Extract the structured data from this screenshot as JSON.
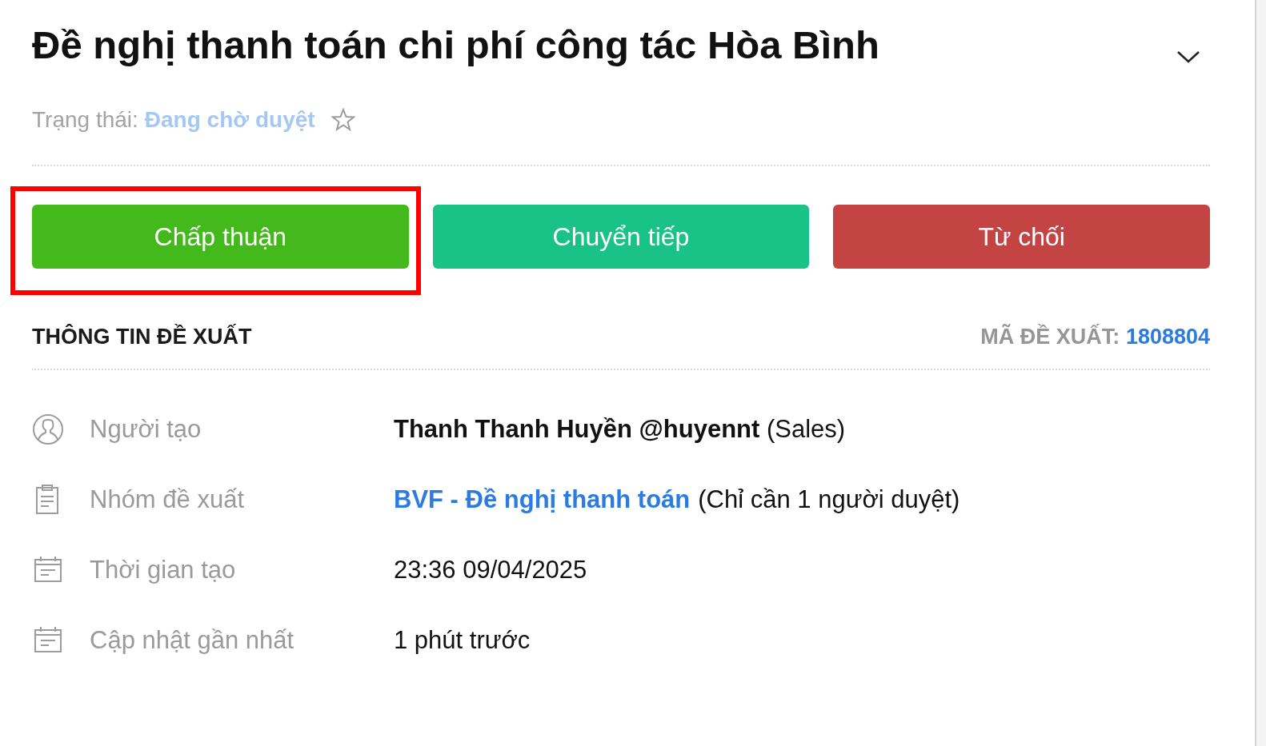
{
  "title": "Đề nghị thanh toán chi phí công tác Hòa Bình",
  "status": {
    "label": "Trạng thái:",
    "value": "Đang chờ duyệt",
    "starred": false
  },
  "actions": [
    {
      "label": "Chấp thuận",
      "color": "#44b91b",
      "highlighted": true
    },
    {
      "label": "Chuyển tiếp",
      "color": "#19c287",
      "highlighted": false
    },
    {
      "label": "Từ chối",
      "color": "#c44444",
      "highlighted": false
    }
  ],
  "section": {
    "title": "THÔNG TIN ĐỀ XUẤT",
    "code_label": "MÃ ĐỀ XUẤT:",
    "code": "1808804"
  },
  "rows": [
    {
      "kind": "person",
      "label": "Người tạo",
      "value": "**Thanh Thanh Huyền @huyennt** (Sales)"
    },
    {
      "kind": "clipboard",
      "label": "Nhóm đề xuất",
      "link": "BVF - Đề nghị thanh toán",
      "value": "(Chỉ cần 1 người duyệt)"
    },
    {
      "kind": "calendar",
      "label": "Thời gian tạo",
      "value": "23:36 09/04/2025"
    },
    {
      "kind": "calendar",
      "label": "Cập nhật gần nhất",
      "value": "1 phút trước"
    }
  ]
}
